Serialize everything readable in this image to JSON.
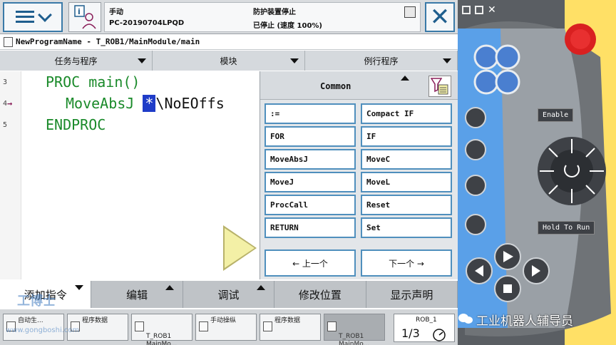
{
  "topbar": {
    "mode": "手动",
    "controller": "PC-20190704LPQD",
    "safety": "防护装置停止",
    "state": "已停止 (速度 100%)"
  },
  "breadcrumb": "NewProgramName - T_ROB1/MainModule/main",
  "tabs": [
    "任务与程序",
    "模块",
    "例行程序"
  ],
  "editor": {
    "line_numbers": [
      "3",
      "4",
      "5"
    ],
    "line3": "PROC main()",
    "line4_cmd": "MoveAbsJ",
    "line4_cursor": "*",
    "line4_rest": "\\NoEOffs",
    "line5": "ENDPROC"
  },
  "common_panel": {
    "title": "Common",
    "instructions": [
      ":=",
      "Compact IF",
      "FOR",
      "IF",
      "MoveAbsJ",
      "MoveC",
      "MoveJ",
      "MoveL",
      "ProcCall",
      "Reset",
      "RETURN",
      "Set"
    ],
    "prev": "← 上一个",
    "next": "下一个 →"
  },
  "function_bar": {
    "add_instruction": "添加指令",
    "edit": "编辑",
    "debug": "调试",
    "modify_position": "修改位置",
    "show_declaration": "显示声明"
  },
  "taskbar": {
    "items": [
      {
        "label": "自动生..."
      },
      {
        "label": "程序数据"
      },
      {
        "label": "T_ROB1\nMainMo..."
      },
      {
        "label": "手动操纵"
      },
      {
        "label": "程序数据"
      },
      {
        "label": "T_ROB1\nMainMo..."
      }
    ],
    "rob_label": "ROB_1",
    "rob_fraction": "1/3"
  },
  "pendant": {
    "enable_label": "Enable",
    "hold_to_run_label": "Hold To Run"
  },
  "watermark": {
    "logo_text": "工博士",
    "url": "www.gongboshi.com",
    "account": "工业机器人辅导员"
  },
  "colors": {
    "accent_blue": "#4f8fbd",
    "code_green": "#1a8a2a",
    "cursor_blue": "#1f3cc8",
    "pendant_gray": "#5a5e63",
    "estop_red": "#d92020",
    "pendant_blue": "#4a7fd0"
  }
}
